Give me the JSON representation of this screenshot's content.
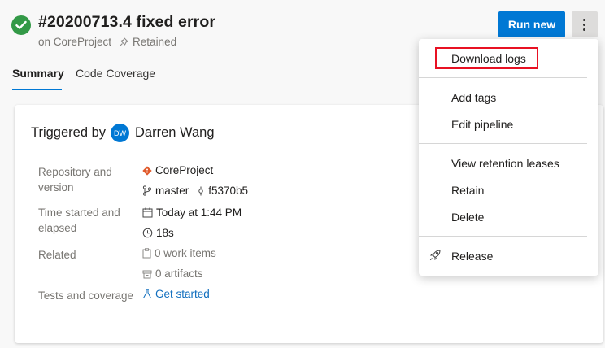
{
  "header": {
    "title": "#20200713.4 fixed error",
    "project": "on CoreProject",
    "retained": "Retained",
    "status_icon": "check-circle-icon",
    "run_new_label": "Run new"
  },
  "tabs": [
    {
      "label": "Summary",
      "active": true
    },
    {
      "label": "Code Coverage",
      "active": false
    }
  ],
  "summary": {
    "triggered_by_label": "Triggered by",
    "avatar_initials": "DW",
    "user_name": "Darren Wang",
    "repository_label": "Repository and version",
    "repository_name": "CoreProject",
    "branch": "master",
    "commit": "f5370b5",
    "time_label": "Time started and elapsed",
    "start_time": "Today at 1:44 PM",
    "elapsed": "18s",
    "related_label": "Related",
    "work_items": "0 work items",
    "artifacts": "0 artifacts",
    "tests_label": "Tests and coverage",
    "tests_link": "Get started"
  },
  "menu": {
    "items": [
      {
        "label": "Download logs",
        "highlighted": true
      },
      {
        "label": "Add tags"
      },
      {
        "label": "Edit pipeline"
      },
      {
        "label": "View retention leases"
      },
      {
        "label": "Retain"
      },
      {
        "label": "Delete"
      },
      {
        "label": "Release",
        "icon": "rocket-icon"
      }
    ]
  },
  "colors": {
    "accent": "#0078d4",
    "success": "#339947",
    "highlight_border": "#e81123"
  }
}
